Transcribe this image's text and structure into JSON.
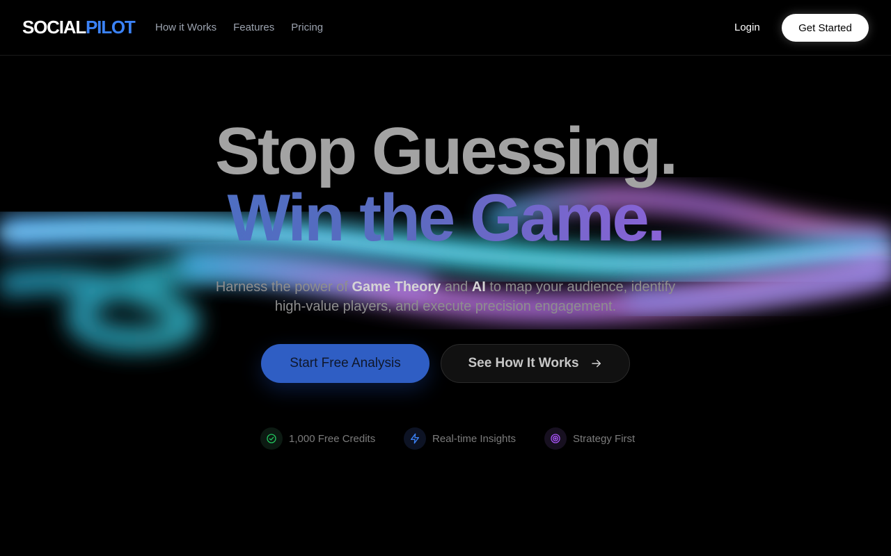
{
  "header": {
    "logo": {
      "part1": "SOCIAL",
      "part2": "PILOT"
    },
    "nav": [
      {
        "label": "How it Works"
      },
      {
        "label": "Features"
      },
      {
        "label": "Pricing"
      }
    ],
    "login_label": "Login",
    "get_started_label": "Get Started"
  },
  "hero": {
    "headline_line1": "Stop Guessing.",
    "headline_line2": "Win the Game.",
    "subtitle": {
      "t1": "Harness the power of ",
      "b1": "Game Theory",
      "t2": " and ",
      "b2": "AI",
      "t3": " to map your audience, identify high-value players, and execute precision engagement."
    },
    "primary_cta": "Start Free Analysis",
    "secondary_cta": "See How It Works"
  },
  "features": [
    {
      "label": "1,000 Free Credits",
      "icon": "check-circle-icon",
      "color": "#22c55e"
    },
    {
      "label": "Real-time Insights",
      "icon": "lightning-icon",
      "color": "#3b82f6"
    },
    {
      "label": "Strategy First",
      "icon": "target-icon",
      "color": "#a855f7"
    }
  ],
  "colors": {
    "accent_blue": "#3b82f6",
    "primary_button": "#2f5ec4",
    "background": "#000000",
    "glow_cyan": "#22d3ee",
    "glow_pink": "#d946ef"
  }
}
